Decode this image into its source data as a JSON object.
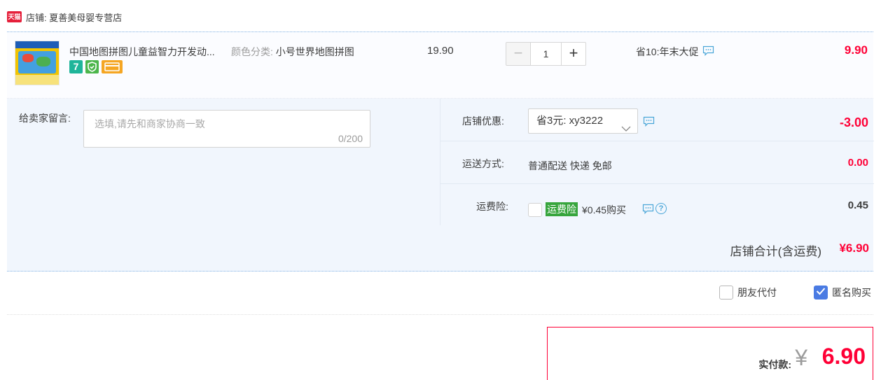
{
  "shop": {
    "badge_text": "天猫",
    "label": "店铺: 夏善美母婴专营店"
  },
  "item": {
    "title": "中国地图拼图儿童益智力开发动...",
    "sku_label": "颜色分类:",
    "sku_value": "小号世界地图拼图",
    "badges": [
      "7",
      "shield",
      "card"
    ],
    "unit_price": "19.90",
    "quantity": "1",
    "promo": "省10:年末大促",
    "total": "9.90"
  },
  "message": {
    "label": "给卖家留言:",
    "placeholder": "选填,请先和商家协商一致",
    "counter": "0/200"
  },
  "coupon": {
    "label": "店铺优惠:",
    "selected": "省3元: xy3222",
    "amount": "-3.00"
  },
  "shipping": {
    "label": "运送方式:",
    "method": "普通配送 快递 免邮",
    "amount": "0.00"
  },
  "insurance": {
    "label": "运费险:",
    "tag": "运费险",
    "price": "¥0.45购买",
    "help": "?",
    "amount": "0.45"
  },
  "subtotal": {
    "label": "店铺合计(含运费)",
    "value": "¥6.90"
  },
  "checkout_options": {
    "friend_pay": "朋友代付",
    "anonymous": "匿名购买",
    "anonymous_checked": true
  },
  "payment": {
    "label": "实付款:",
    "currency": "¥",
    "value": "6.90"
  },
  "colors": {
    "price_red": "#ff0036",
    "panel_blue": "#f1f6fd",
    "check_blue": "#4a7be3",
    "insurance_green": "#37a53d",
    "tmall_red": "#e5203b"
  }
}
